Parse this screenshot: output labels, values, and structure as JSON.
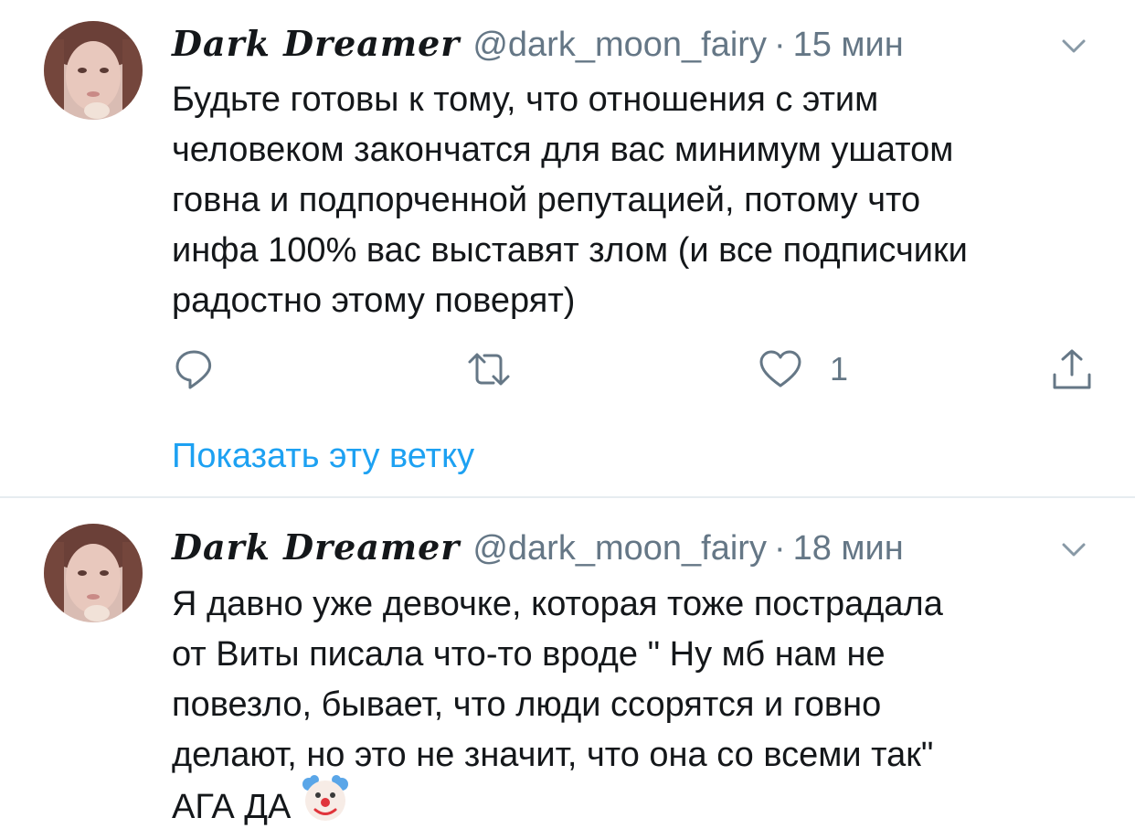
{
  "tweets": [
    {
      "author_name": "Dark Dreamer",
      "handle": "@dark_moon_fairy",
      "separator": "·",
      "time": "15 мин",
      "text_lines": [
        "Будьте готовы к тому, что отношения с этим",
        "человеком закончатся для вас минимум ушатом",
        "говна и подпорченной репутацией, потому что",
        "инфа 100% вас выставят злом (и все подписчики",
        "радостно этому поверят)"
      ],
      "like_count": "1",
      "show_thread": "Показать эту ветку"
    },
    {
      "author_name": "Dark Dreamer",
      "handle": "@dark_moon_fairy",
      "separator": "·",
      "time": "18 мин",
      "text_lines": [
        "Я давно уже девочке, которая тоже пострадала",
        "от Виты писала что-то вроде \" Ну мб нам не",
        "повезло, бывает, что люди ссорятся и говно",
        "делают, но это не значит, что она со всеми так\"",
        "АГА ДА"
      ],
      "emoji": "clown-face"
    }
  ],
  "icons": {
    "reply": "speech-bubble-icon",
    "retweet": "retweet-icon",
    "like": "heart-icon",
    "share": "share-icon",
    "menu": "chevron-down-icon"
  },
  "colors": {
    "text": "#14171a",
    "secondary": "#657786",
    "link": "#1da1f2",
    "divider": "#e6ecf0"
  }
}
